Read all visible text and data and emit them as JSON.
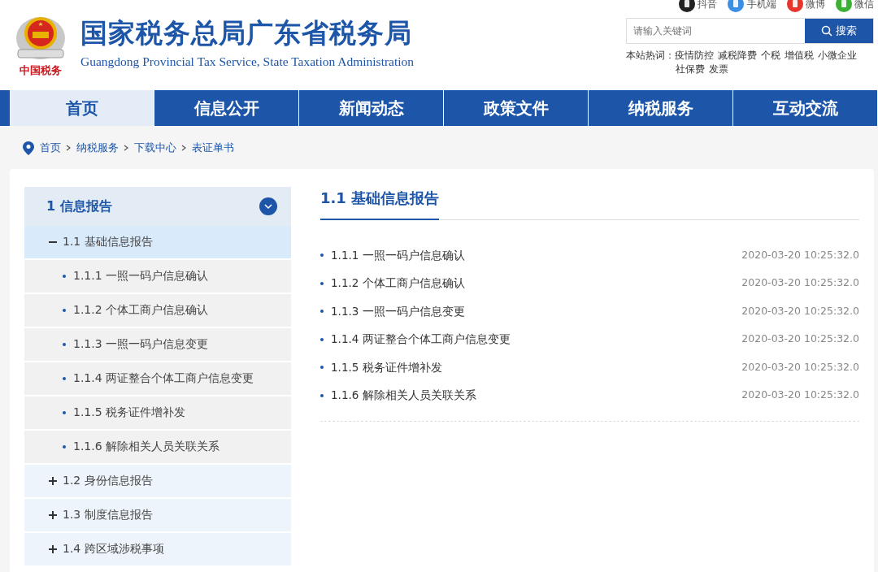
{
  "header": {
    "title": "国家税务总局广东省税务局",
    "subtitle": "Guangdong Provincial Tax Service, State Taxation Administration",
    "logo_caption": "中国税务",
    "social": [
      {
        "kind": "douyin",
        "label": "抖音"
      },
      {
        "kind": "mobile",
        "label": "手机端"
      },
      {
        "kind": "weibo",
        "label": "微博"
      },
      {
        "kind": "wechat",
        "label": "微信"
      }
    ],
    "search": {
      "placeholder": "请输入关键词",
      "button": "搜索"
    },
    "hot_label": "本站热词：",
    "hot_words": [
      "疫情防控",
      "减税降费",
      "个税",
      "增值税",
      "小微企业",
      "社保费",
      "发票"
    ]
  },
  "nav": [
    {
      "label": "首页",
      "selected": true
    },
    {
      "label": "信息公开",
      "selected": false
    },
    {
      "label": "新闻动态",
      "selected": false
    },
    {
      "label": "政策文件",
      "selected": false
    },
    {
      "label": "纳税服务",
      "selected": false
    },
    {
      "label": "互动交流",
      "selected": false
    }
  ],
  "breadcrumb": [
    "首页",
    "纳税服务",
    "下载中心",
    "表证单书"
  ],
  "sidebar": {
    "title": "1 信息报告",
    "expanded": true,
    "items": [
      {
        "label": "1.1 基础信息报告",
        "expanded": true,
        "selected": true,
        "children": [
          {
            "label": "1.1.1 一照一码户信息确认"
          },
          {
            "label": "1.1.2 个体工商户信息确认"
          },
          {
            "label": "1.1.3 一照一码户信息变更"
          },
          {
            "label": "1.1.4 两证整合个体工商户信息变更"
          },
          {
            "label": "1.1.5 税务证件增补发"
          },
          {
            "label": "1.1.6 解除相关人员关联关系"
          }
        ]
      },
      {
        "label": "1.2 身份信息报告",
        "expanded": false,
        "selected": false
      },
      {
        "label": "1.3 制度信息报告",
        "expanded": false,
        "selected": false
      },
      {
        "label": "1.4 跨区域涉税事项",
        "expanded": false,
        "selected": false
      }
    ]
  },
  "main": {
    "title": "1.1 基础信息报告",
    "files": [
      {
        "title": "1.1.1 一照一码户信息确认",
        "date": "2020-03-20 10:25:32.0"
      },
      {
        "title": "1.1.2 个体工商户信息确认",
        "date": "2020-03-20 10:25:32.0"
      },
      {
        "title": "1.1.3 一照一码户信息变更",
        "date": "2020-03-20 10:25:32.0"
      },
      {
        "title": "1.1.4 两证整合个体工商户信息变更",
        "date": "2020-03-20 10:25:32.0"
      },
      {
        "title": "1.1.5 税务证件增补发",
        "date": "2020-03-20 10:25:32.0"
      },
      {
        "title": "1.1.6 解除相关人员关联关系",
        "date": "2020-03-20 10:25:32.0"
      }
    ]
  }
}
